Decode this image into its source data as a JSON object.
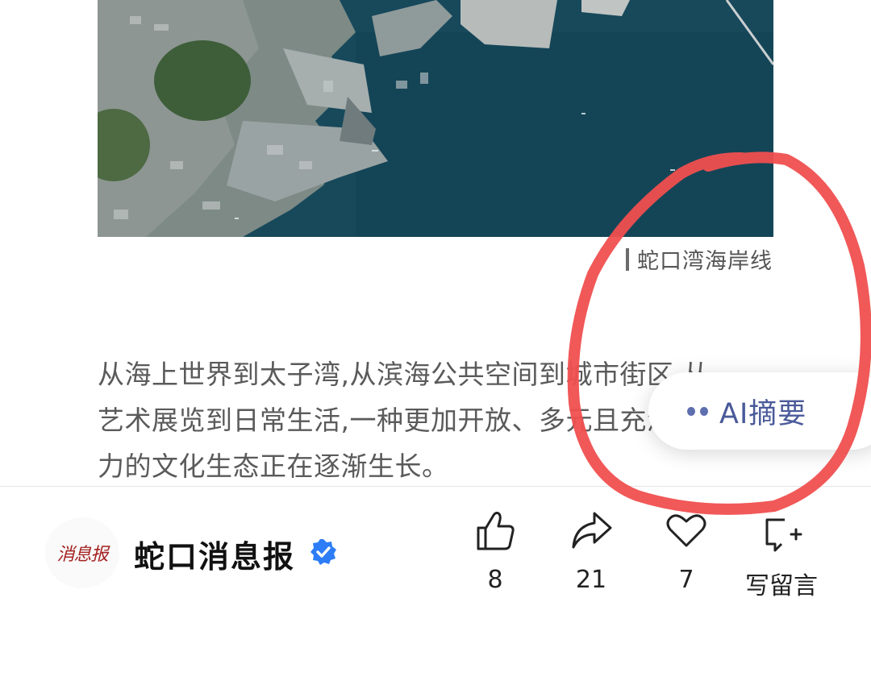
{
  "photo": {
    "caption": "蛇口湾海岸线"
  },
  "article": {
    "paragraph": "从海上世界到太子湾,从滨海公共空间到城市街区,从\n艺术展览到日常生活,一种更加开放、多元且充满活\n力的文化生态正在逐渐生长。"
  },
  "ai_summary": {
    "label": "AI摘要",
    "dot_color": "#5e6fb0"
  },
  "account": {
    "logo_text": "消息报",
    "name": "蛇口消息报",
    "verified": true,
    "verified_color": "#2d7df6"
  },
  "actions": {
    "like_count": "8",
    "share_count": "21",
    "favorite_count": "7",
    "comment_label": "写留言"
  },
  "annotation": {
    "shape": "hand-drawn circle",
    "color": "#f04f4f"
  }
}
